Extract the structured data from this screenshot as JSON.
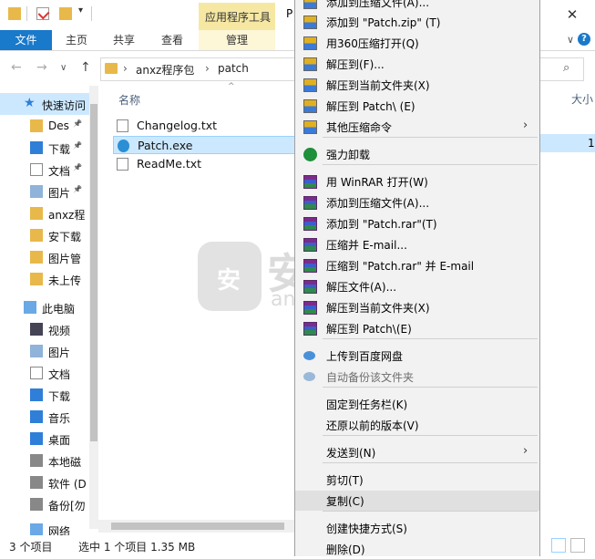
{
  "titlebar": {
    "app_tools_label": "应用程序工具",
    "window_title_fragment": "P",
    "close_glyph": "✕"
  },
  "ribbon": {
    "tabs": [
      "文件",
      "主页",
      "共享",
      "查看"
    ],
    "manage_tab": "管理",
    "help_glyph": "?"
  },
  "navbar": {
    "back": "←",
    "forward": "→",
    "recent": "∨",
    "up": "↑",
    "breadcrumb": [
      "anxz程序包",
      "patch"
    ],
    "separator": "›",
    "search_icon": "search-icon"
  },
  "sidebar": {
    "items": [
      {
        "label": "快速访问",
        "icon": "star-icon",
        "selected": true
      },
      {
        "label": "Des",
        "icon": "folder-icon",
        "pinned": true
      },
      {
        "label": "下载",
        "icon": "download-icon",
        "pinned": true
      },
      {
        "label": "文档",
        "icon": "document-icon",
        "pinned": true
      },
      {
        "label": "图片",
        "icon": "picture-icon",
        "pinned": true
      },
      {
        "label": "anxz程",
        "icon": "folder-icon"
      },
      {
        "label": "安下载",
        "icon": "folder-icon"
      },
      {
        "label": "图片管",
        "icon": "folder-icon"
      },
      {
        "label": "未上传",
        "icon": "folder-icon"
      },
      {
        "label": "此电脑",
        "icon": "computer-icon"
      },
      {
        "label": "视频",
        "icon": "video-icon"
      },
      {
        "label": "图片",
        "icon": "picture-icon"
      },
      {
        "label": "文档",
        "icon": "document-icon"
      },
      {
        "label": "下载",
        "icon": "download-icon"
      },
      {
        "label": "音乐",
        "icon": "music-icon"
      },
      {
        "label": "桌面",
        "icon": "desktop-icon"
      },
      {
        "label": "本地磁",
        "icon": "drive-icon"
      },
      {
        "label": "软件 (D",
        "icon": "drive-icon"
      },
      {
        "label": "备份[勿",
        "icon": "drive-icon"
      },
      {
        "label": "网络",
        "icon": "network-icon"
      }
    ]
  },
  "filelist": {
    "column_name": "名称",
    "column_size": "大小",
    "files": [
      {
        "name": "Changelog.txt",
        "icon": "text-file-icon",
        "selected": false
      },
      {
        "name": "Patch.exe",
        "icon": "exe-file-icon",
        "selected": true
      },
      {
        "name": "ReadMe.txt",
        "icon": "text-file-icon",
        "selected": false
      }
    ],
    "selected_size_fragment": "1"
  },
  "context_menu": {
    "items": [
      {
        "label": "添加到压缩文件(A)...",
        "icon": "zip360-icon"
      },
      {
        "label": "添加到 \"Patch.zip\" (T)",
        "icon": "zip360-icon"
      },
      {
        "label": "用360压缩打开(Q)",
        "icon": "zip360-icon"
      },
      {
        "label": "解压到(F)...",
        "icon": "zip360-icon"
      },
      {
        "label": "解压到当前文件夹(X)",
        "icon": "zip360-icon"
      },
      {
        "label": "解压到 Patch\\ (E)",
        "icon": "zip360-icon"
      },
      {
        "label": "其他压缩命令",
        "icon": "zip360-icon",
        "submenu": true
      },
      {
        "label": "强力卸载",
        "icon": "uninstall-icon",
        "sep_before": true
      },
      {
        "label": "用 WinRAR 打开(W)",
        "icon": "winrar-icon",
        "sep_before": true
      },
      {
        "label": "添加到压缩文件(A)...",
        "icon": "winrar-icon"
      },
      {
        "label": "添加到 \"Patch.rar\"(T)",
        "icon": "winrar-icon"
      },
      {
        "label": "压缩并 E-mail...",
        "icon": "winrar-icon"
      },
      {
        "label": "压缩到 \"Patch.rar\" 并 E-mail",
        "icon": "winrar-icon"
      },
      {
        "label": "解压文件(A)...",
        "icon": "winrar-icon"
      },
      {
        "label": "解压到当前文件夹(X)",
        "icon": "winrar-icon"
      },
      {
        "label": "解压到 Patch\\(E)",
        "icon": "winrar-icon"
      },
      {
        "label": "上传到百度网盘",
        "icon": "cloud-icon",
        "sep_before": true
      },
      {
        "label": "自动备份该文件夹",
        "icon": "cloud-icon",
        "disabled": true
      },
      {
        "label": "固定到任务栏(K)",
        "icon": "",
        "sep_before": true
      },
      {
        "label": "还原以前的版本(V)",
        "icon": ""
      },
      {
        "label": "发送到(N)",
        "icon": "",
        "submenu": true,
        "sep_before": true
      },
      {
        "label": "剪切(T)",
        "icon": "",
        "sep_before": true
      },
      {
        "label": "复制(C)",
        "icon": "",
        "highlighted": true
      },
      {
        "label": "创建快捷方式(S)",
        "icon": "",
        "sep_before": true
      },
      {
        "label": "删除(D)",
        "icon": ""
      }
    ],
    "submenu_arrow": "›"
  },
  "statusbar": {
    "item_count": "3 个项目",
    "selection": "选中 1 个项目  1.35 MB"
  },
  "watermark": {
    "badge_char": "安",
    "text": "安下载",
    "sub": "anxz.com"
  }
}
